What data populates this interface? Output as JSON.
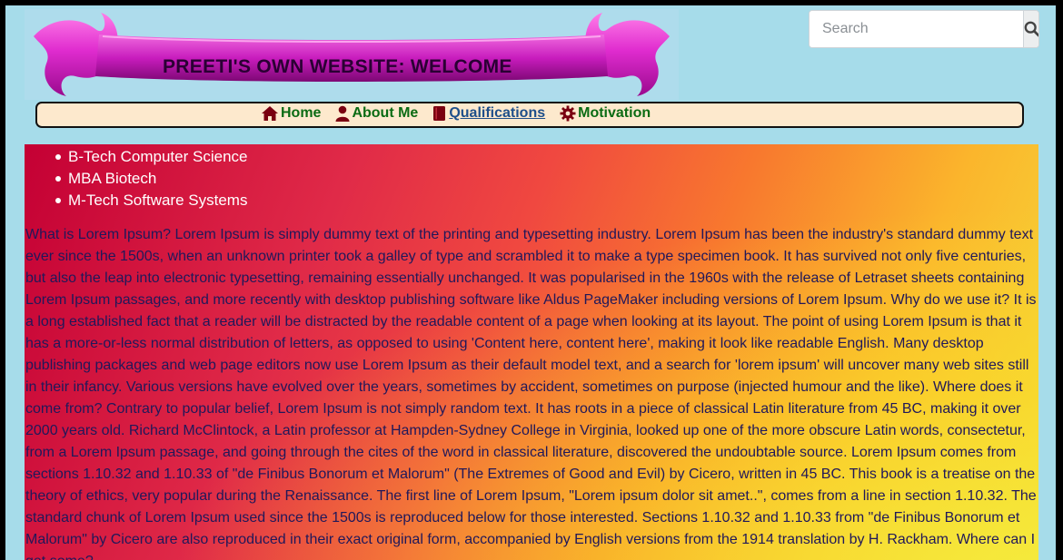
{
  "banner": {
    "title": "PREETI'S OWN WEBSITE: WELCOME"
  },
  "search": {
    "placeholder": "Search"
  },
  "nav": {
    "items": [
      {
        "label": "Home",
        "icon": "home-icon"
      },
      {
        "label": "About Me",
        "icon": "user-icon"
      },
      {
        "label": "Qualifications",
        "icon": "book-icon",
        "active": true
      },
      {
        "label": "Motivation",
        "icon": "cog-icon"
      }
    ]
  },
  "qualifications": [
    "B-Tech Computer Science",
    "MBA Biotech",
    "M-Tech Software Systems"
  ],
  "body_text": "What is Lorem Ipsum? Lorem Ipsum is simply dummy text of the printing and typesetting industry. Lorem Ipsum has been the industry's standard dummy text ever since the 1500s, when an unknown printer took a galley of type and scrambled it to make a type specimen book. It has survived not only five centuries, but also the leap into electronic typesetting, remaining essentially unchanged. It was popularised in the 1960s with the release of Letraset sheets containing Lorem Ipsum passages, and more recently with desktop publishing software like Aldus PageMaker including versions of Lorem Ipsum. Why do we use it? It is a long established fact that a reader will be distracted by the readable content of a page when looking at its layout. The point of using Lorem Ipsum is that it has a more-or-less normal distribution of letters, as opposed to using 'Content here, content here', making it look like readable English. Many desktop publishing packages and web page editors now use Lorem Ipsum as their default model text, and a search for 'lorem ipsum' will uncover many web sites still in their infancy. Various versions have evolved over the years, sometimes by accident, sometimes on purpose (injected humour and the like). Where does it come from? Contrary to popular belief, Lorem Ipsum is not simply random text. It has roots in a piece of classical Latin literature from 45 BC, making it over 2000 years old. Richard McClintock, a Latin professor at Hampden-Sydney College in Virginia, looked up one of the more obscure Latin words, consectetur, from a Lorem Ipsum passage, and going through the cites of the word in classical literature, discovered the undoubtable source. Lorem Ipsum comes from sections 1.10.32 and 1.10.33 of \"de Finibus Bonorum et Malorum\" (The Extremes of Good and Evil) by Cicero, written in 45 BC. This book is a treatise on the theory of ethics, very popular during the Renaissance. The first line of Lorem Ipsum, \"Lorem ipsum dolor sit amet..\", comes from a line in section 1.10.32. The standard chunk of Lorem Ipsum used since the 1500s is reproduced below for those interested. Sections 1.10.32 and 1.10.33 from \"de Finibus Bonorum et Malorum\" by Cicero are also reproduced in their exact original form, accompanied by English versions from the 1914 translation by H. Rackham. Where can I get some?",
  "colors": {
    "page_bg": "#a6dcea",
    "nav_bg": "#fde9cd",
    "nav_link": "#0b6b13",
    "nav_active": "#1e4f8a",
    "icon": "#7a0010",
    "ribbon": "#d81fc4",
    "body_text": "#20185a"
  }
}
